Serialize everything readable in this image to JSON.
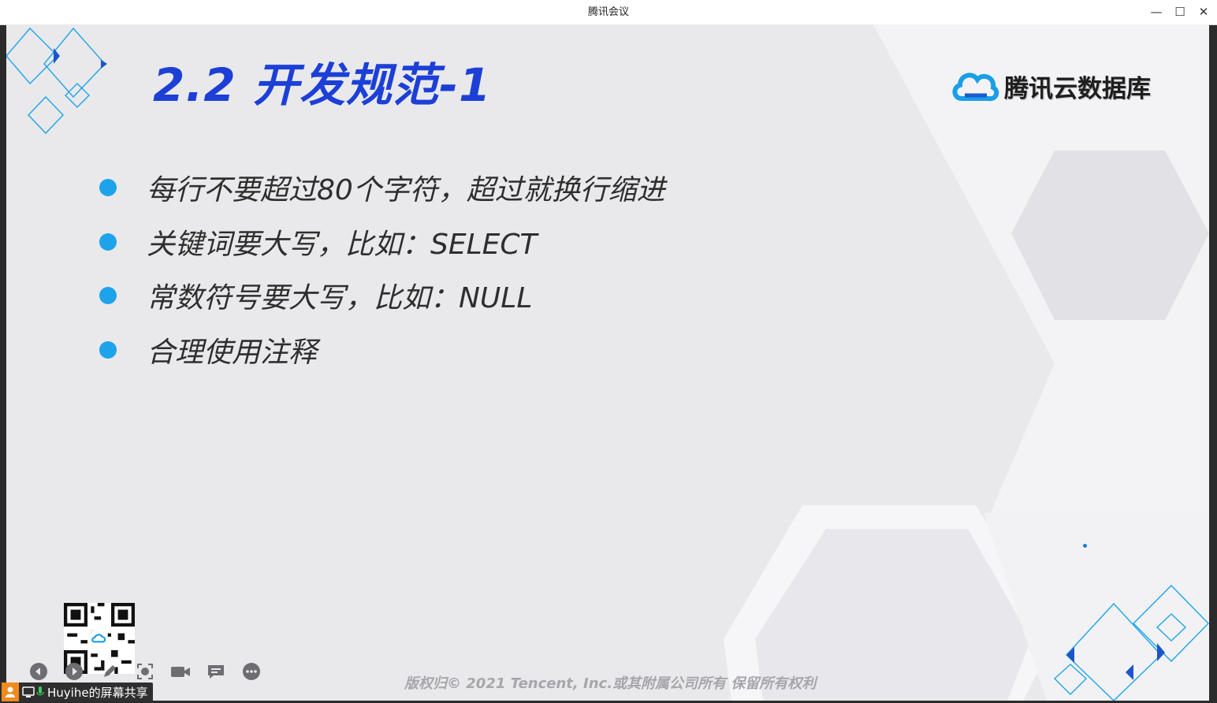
{
  "window": {
    "title": "腾讯会议",
    "minimize_glyph": "—",
    "maximize_glyph": "☐",
    "close_glyph": "✕"
  },
  "slide": {
    "title": "2.2 开发规范-1",
    "brand": "腾讯云数据库",
    "bullets": [
      "每行不要超过80个字符，超过就换行缩进",
      "关键词要大写，比如：SELECT",
      "常数符号要大写，比如：NULL",
      "合理使用注释"
    ],
    "copyright": "版权归© 2021 Tencent, Inc.或其附属公司所有 保留所有权利"
  },
  "toolbar": {
    "icons": [
      "prev-icon",
      "next-icon",
      "pen-icon",
      "screenshot-icon",
      "camera-icon",
      "chat-icon",
      "more-icon"
    ]
  },
  "share_badge": {
    "label": "Huyihe的屏幕共享"
  },
  "colors": {
    "title_blue": "#1c3fd6",
    "bullet_blue": "#1ea3ea",
    "slide_bg": "#e9e9ec"
  }
}
